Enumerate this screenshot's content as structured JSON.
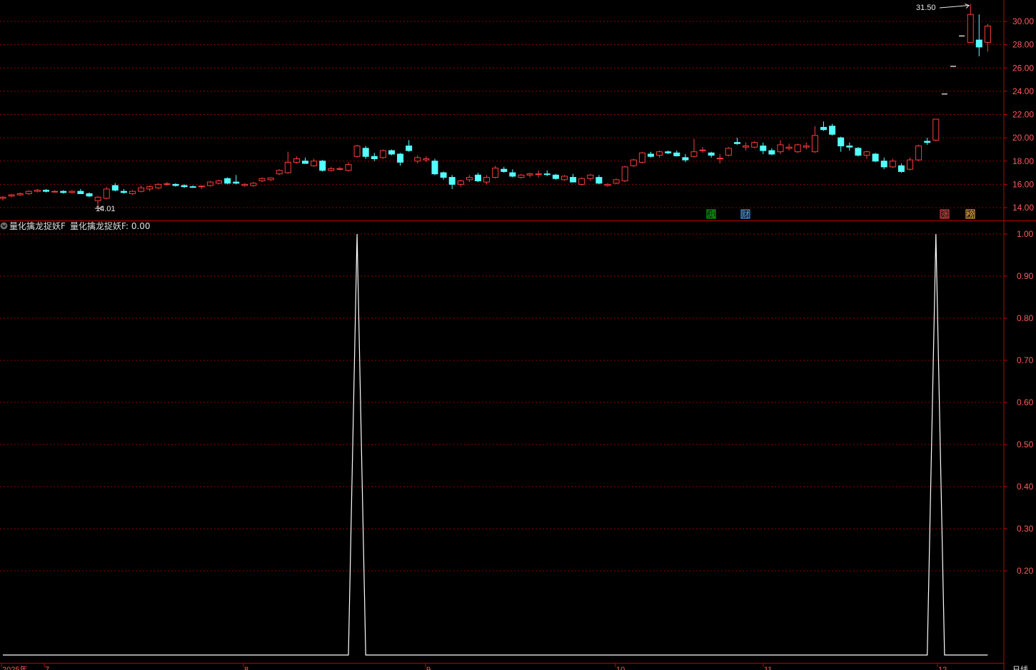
{
  "indicator": {
    "name": "量化擒龙捉妖F",
    "value_label": "量化擒龙捉妖F: 0.00",
    "color": "#ffffff"
  },
  "colors": {
    "up": "#ff3b3b",
    "down": "#54ffff",
    "grid": "#8b0000",
    "axis_text": "#ff5a5a",
    "border": "#c00000"
  },
  "price_axis": {
    "ticks": [
      "30.00",
      "28.00",
      "26.00",
      "24.00",
      "22.00",
      "20.00",
      "18.00",
      "16.00",
      "14.00"
    ],
    "range": [
      13.0,
      32.0
    ]
  },
  "indicator_axis": {
    "ticks": [
      "1.00",
      "0.90",
      "0.80",
      "0.70",
      "0.60",
      "0.50",
      "0.40",
      "0.30",
      "0.20"
    ],
    "range": [
      0.0,
      1.02
    ]
  },
  "annotations": {
    "high": "31.50",
    "low": "14.01"
  },
  "badges": [
    {
      "text": "减",
      "color": "#00c000",
      "border": "#00c000"
    },
    {
      "text": "财",
      "color": "#4aa8ff",
      "border": "#4aa8ff"
    },
    {
      "text": "涨",
      "color": "#ff4040",
      "border": "#ff4040"
    },
    {
      "text": "榜",
      "color": "#ffb040",
      "border": "#ffb040"
    }
  ],
  "date_axis": {
    "labels": [
      "2025年",
      "7",
      "8",
      "9",
      "10",
      "11",
      "12"
    ],
    "period": "日线"
  },
  "chart_data": {
    "type": "candlestick",
    "candles": [
      [
        14.8,
        15.0,
        14.6,
        14.9
      ],
      [
        15.0,
        15.2,
        14.9,
        15.1
      ],
      [
        15.1,
        15.3,
        15.0,
        15.2
      ],
      [
        15.2,
        15.5,
        15.1,
        15.4
      ],
      [
        15.4,
        15.6,
        15.3,
        15.5
      ],
      [
        15.5,
        15.6,
        15.3,
        15.4
      ],
      [
        15.4,
        15.5,
        15.3,
        15.4
      ],
      [
        15.4,
        15.5,
        15.2,
        15.3
      ],
      [
        15.3,
        15.5,
        15.2,
        15.4
      ],
      [
        15.4,
        15.6,
        15.2,
        15.2
      ],
      [
        15.2,
        15.3,
        14.9,
        15.0
      ],
      [
        14.6,
        15.0,
        14.01,
        14.9
      ],
      [
        14.8,
        15.8,
        14.7,
        15.6
      ],
      [
        15.9,
        16.1,
        15.4,
        15.5
      ],
      [
        15.4,
        15.6,
        15.2,
        15.3
      ],
      [
        15.2,
        15.5,
        15.1,
        15.4
      ],
      [
        15.4,
        15.9,
        15.3,
        15.7
      ],
      [
        15.6,
        15.9,
        15.4,
        15.8
      ],
      [
        15.7,
        16.1,
        15.6,
        16.0
      ],
      [
        16.0,
        16.2,
        15.9,
        16.05
      ],
      [
        16.0,
        16.1,
        15.8,
        15.9
      ],
      [
        15.9,
        16.0,
        15.7,
        15.8
      ],
      [
        15.8,
        15.9,
        15.7,
        15.75
      ],
      [
        15.8,
        15.9,
        15.6,
        15.85
      ],
      [
        15.9,
        16.3,
        15.8,
        16.2
      ],
      [
        16.1,
        16.4,
        16.0,
        16.3
      ],
      [
        16.5,
        16.6,
        16.0,
        16.1
      ],
      [
        16.2,
        16.8,
        16.0,
        16.1
      ],
      [
        15.9,
        16.1,
        15.8,
        16.0
      ],
      [
        15.9,
        16.2,
        15.8,
        16.1
      ],
      [
        16.3,
        16.6,
        16.2,
        16.5
      ],
      [
        16.4,
        16.6,
        16.3,
        16.55
      ],
      [
        16.9,
        17.3,
        16.8,
        17.2
      ],
      [
        17.0,
        18.8,
        16.9,
        17.9
      ],
      [
        17.9,
        18.4,
        17.8,
        18.2
      ],
      [
        18.0,
        18.3,
        17.8,
        17.8
      ],
      [
        17.6,
        18.2,
        17.5,
        18.0
      ],
      [
        18.0,
        18.1,
        17.1,
        17.2
      ],
      [
        17.2,
        17.5,
        17.1,
        17.35
      ],
      [
        17.3,
        17.5,
        17.2,
        17.35
      ],
      [
        17.2,
        17.9,
        17.1,
        17.7
      ],
      [
        18.4,
        19.4,
        18.3,
        19.3
      ],
      [
        19.1,
        19.3,
        18.2,
        18.4
      ],
      [
        18.4,
        18.7,
        18.0,
        18.2
      ],
      [
        18.3,
        19.0,
        18.2,
        18.9
      ],
      [
        18.9,
        19.0,
        18.5,
        18.6
      ],
      [
        18.6,
        18.7,
        17.6,
        17.9
      ],
      [
        19.3,
        19.8,
        18.8,
        18.9
      ],
      [
        18.0,
        18.5,
        17.8,
        18.3
      ],
      [
        18.1,
        18.4,
        17.9,
        18.2
      ],
      [
        18.0,
        18.2,
        16.8,
        16.9
      ],
      [
        17.0,
        17.1,
        16.4,
        16.6
      ],
      [
        16.6,
        16.8,
        15.6,
        16.0
      ],
      [
        16.0,
        16.4,
        15.8,
        16.3
      ],
      [
        16.4,
        16.8,
        16.2,
        16.6
      ],
      [
        16.8,
        17.0,
        16.2,
        16.3
      ],
      [
        16.2,
        16.8,
        16.0,
        16.6
      ],
      [
        16.6,
        17.6,
        16.5,
        17.4
      ],
      [
        17.3,
        17.5,
        17.0,
        17.1
      ],
      [
        17.0,
        17.3,
        16.6,
        16.7
      ],
      [
        16.6,
        16.9,
        16.5,
        16.8
      ],
      [
        16.8,
        17.0,
        16.6,
        16.9
      ],
      [
        16.85,
        17.2,
        16.6,
        16.9
      ],
      [
        16.9,
        17.2,
        16.7,
        16.85
      ],
      [
        16.8,
        16.9,
        16.4,
        16.5
      ],
      [
        16.4,
        16.8,
        16.3,
        16.7
      ],
      [
        16.6,
        16.9,
        16.2,
        16.2
      ],
      [
        16.0,
        16.6,
        15.9,
        16.5
      ],
      [
        16.5,
        16.9,
        16.3,
        16.8
      ],
      [
        16.6,
        16.8,
        16.0,
        16.1
      ],
      [
        15.9,
        16.1,
        15.8,
        16.0
      ],
      [
        16.1,
        16.5,
        16.0,
        16.4
      ],
      [
        16.3,
        17.6,
        16.2,
        17.5
      ],
      [
        17.6,
        18.2,
        17.5,
        18.1
      ],
      [
        17.9,
        18.8,
        17.8,
        18.7
      ],
      [
        18.6,
        18.8,
        18.3,
        18.4
      ],
      [
        18.5,
        18.9,
        18.3,
        18.8
      ],
      [
        18.8,
        18.9,
        18.6,
        18.7
      ],
      [
        18.7,
        18.9,
        18.4,
        18.45
      ],
      [
        18.3,
        18.6,
        17.9,
        18.1
      ],
      [
        18.4,
        19.9,
        18.3,
        18.8
      ],
      [
        18.9,
        19.2,
        18.7,
        18.95
      ],
      [
        18.7,
        18.8,
        18.3,
        18.5
      ],
      [
        18.2,
        18.6,
        17.8,
        18.25
      ],
      [
        18.5,
        19.2,
        18.4,
        19.1
      ],
      [
        19.6,
        20.0,
        19.4,
        19.5
      ],
      [
        19.2,
        19.6,
        18.9,
        19.3
      ],
      [
        19.2,
        19.7,
        19.1,
        19.6
      ],
      [
        19.3,
        19.6,
        18.6,
        18.9
      ],
      [
        18.9,
        19.1,
        18.5,
        18.6
      ],
      [
        18.8,
        19.8,
        18.6,
        19.4
      ],
      [
        19.1,
        19.5,
        18.9,
        19.2
      ],
      [
        18.8,
        19.5,
        18.7,
        19.4
      ],
      [
        19.2,
        19.6,
        19.0,
        19.3
      ],
      [
        18.8,
        21.0,
        18.7,
        20.2
      ],
      [
        20.9,
        21.4,
        20.6,
        20.7
      ],
      [
        21.0,
        21.2,
        20.2,
        20.3
      ],
      [
        20.0,
        20.1,
        18.8,
        19.3
      ],
      [
        19.3,
        19.6,
        18.9,
        19.2
      ],
      [
        19.1,
        19.2,
        18.4,
        18.5
      ],
      [
        18.5,
        18.9,
        18.2,
        18.8
      ],
      [
        18.6,
        18.7,
        17.9,
        18.0
      ],
      [
        18.0,
        18.3,
        17.3,
        17.5
      ],
      [
        17.5,
        18.2,
        17.4,
        18.0
      ],
      [
        17.6,
        17.8,
        17.0,
        17.1
      ],
      [
        17.3,
        18.3,
        17.2,
        18.1
      ],
      [
        18.1,
        19.4,
        18.0,
        19.3
      ],
      [
        19.7,
        20.0,
        19.4,
        19.6
      ],
      [
        19.8,
        21.6,
        19.7,
        21.6
      ],
      [
        23.76,
        23.76,
        23.76,
        23.76
      ],
      [
        26.14,
        26.14,
        26.14,
        26.14
      ],
      [
        28.75,
        28.75,
        28.75,
        28.75
      ],
      [
        28.2,
        31.5,
        28.2,
        30.6
      ],
      [
        28.4,
        30.6,
        27.0,
        27.8
      ],
      [
        28.2,
        29.8,
        27.4,
        29.6
      ]
    ],
    "indicator": {
      "name": "量化擒龙捉妖F",
      "spikes_at": [
        41,
        108
      ],
      "value": 0.0
    }
  }
}
